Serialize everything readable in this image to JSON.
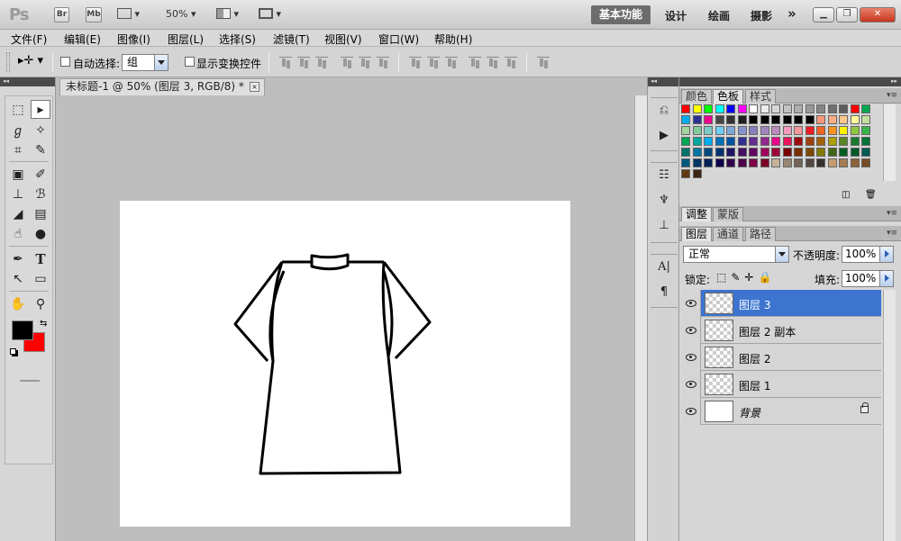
{
  "app": {
    "logo": "Ps",
    "bridge_label": "Br",
    "minibridge_label": "Mb",
    "zoom": "50%",
    "workspaces": [
      "基本功能",
      "设计",
      "绘画",
      "摄影"
    ],
    "more": "»"
  },
  "menu": [
    "文件(F)",
    "编辑(E)",
    "图像(I)",
    "图层(L)",
    "选择(S)",
    "滤镜(T)",
    "视图(V)",
    "窗口(W)",
    "帮助(H)"
  ],
  "options": {
    "auto_select_label": "自动选择:",
    "auto_select_value": "组",
    "show_transform_label": "显示变换控件"
  },
  "document": {
    "tab_title": "未标题-1 @ 50% (图层 3, RGB/8) *",
    "close": "×"
  },
  "panels": {
    "color_tabs": [
      "颜色",
      "色板",
      "样式"
    ],
    "active_color_tab": "色板",
    "adjust_tabs": [
      "调整",
      "蒙版"
    ],
    "layer_tabs": [
      "图层",
      "通道",
      "路径"
    ],
    "blend_mode": "正常",
    "opacity_label": "不透明度:",
    "opacity": "100%",
    "lock_label": "锁定:",
    "fill_label": "填充:",
    "fill": "100%"
  },
  "swatch_colors": [
    [
      "#ff0000",
      "#ffff00",
      "#00ff00",
      "#00ffff",
      "#0000ff",
      "#ff00ff",
      "#ffffff",
      "#ebebeb",
      "#d6d6d6",
      "#c2c2c2",
      "#adadad",
      "#999999",
      "#858585",
      "#707070",
      "#5c5c5c",
      "#ff0000",
      "#00a651"
    ],
    [
      "#00aeef",
      "#2e3192",
      "#ec008c",
      "#474747",
      "#333333",
      "#1f1f1f",
      "#000000",
      "#000000",
      "#000000",
      "#000000",
      "#000000",
      "#000000",
      "#f7977a",
      "#fbad82",
      "#fdc68c",
      "#fff79a",
      "#c4df9b"
    ],
    [
      "#a3d39c",
      "#82ca9c",
      "#7accc8",
      "#6dcff6",
      "#7da7d9",
      "#8393ca",
      "#8781bd",
      "#a186be",
      "#bd8cbf",
      "#f49ac1",
      "#f5989d",
      "#ed1c24",
      "#f26522",
      "#f7941d",
      "#fff200",
      "#8dc63f",
      "#39b54a"
    ],
    [
      "#00a651",
      "#00a99d",
      "#00aeef",
      "#0072bc",
      "#0054a6",
      "#2e3192",
      "#662d91",
      "#92278f",
      "#ec008c",
      "#ed145b",
      "#9e0b0f",
      "#a0410d",
      "#a36209",
      "#aba000",
      "#598527",
      "#1a7b30",
      "#007236"
    ],
    [
      "#00746b",
      "#0076a3",
      "#004b80",
      "#003471",
      "#1b1464",
      "#440e62",
      "#630460",
      "#9e005d",
      "#9e0039",
      "#790000",
      "#7b2e00",
      "#7d4900",
      "#827b00",
      "#406618",
      "#005e20",
      "#005826",
      "#005952"
    ],
    [
      "#005b7f",
      "#003663",
      "#002157",
      "#0d004c",
      "#32004b",
      "#4b0049",
      "#7b0046",
      "#7a0026",
      "#c7b299",
      "#998675",
      "#736357",
      "#534741",
      "#37302d",
      "#c69c6d",
      "#a67c52",
      "#8c6239",
      "#754c24"
    ],
    [
      "#603913",
      "#3c2415"
    ]
  ],
  "layers": [
    {
      "name": "图层 3",
      "selected": true,
      "locked": false,
      "transparent": true
    },
    {
      "name": "图层 2 副本",
      "selected": false,
      "locked": false,
      "transparent": true
    },
    {
      "name": "图层 2",
      "selected": false,
      "locked": false,
      "transparent": true
    },
    {
      "name": "图层 1",
      "selected": false,
      "locked": false,
      "transparent": true
    },
    {
      "name": "背景",
      "selected": false,
      "locked": true,
      "transparent": false
    }
  ]
}
